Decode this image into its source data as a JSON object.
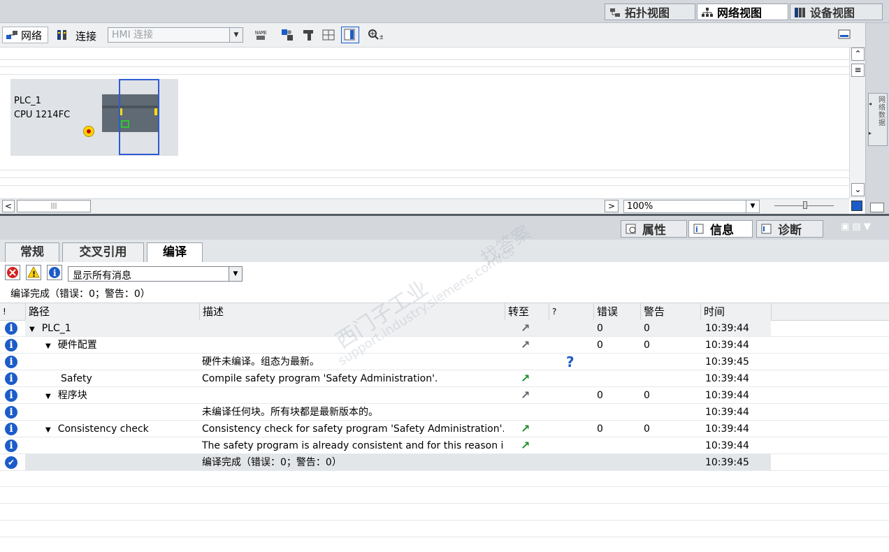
{
  "view_tabs": {
    "topology": "拓扑视图",
    "network": "网络视图",
    "device": "设备视图"
  },
  "toolbar": {
    "network_label": "网络",
    "connection_label": "连接",
    "connection_type": "HMI 连接"
  },
  "device": {
    "name": "PLC_1",
    "type": "CPU 1214FC"
  },
  "side_panel_label": "网络数据",
  "zoom": "100%",
  "inspector_tabs": {
    "properties": "属性",
    "info": "信息",
    "diagnostics": "诊断"
  },
  "sub_tabs": {
    "general": "常规",
    "cross_ref": "交叉引用",
    "compile": "编译"
  },
  "filter": {
    "selected": "显示所有消息"
  },
  "summary": "编译完成（错误：0；警告：0）",
  "columns": {
    "flag": "!",
    "path": "路径",
    "description": "描述",
    "goto": "转至",
    "question": "?",
    "errors": "错误",
    "warnings": "警告",
    "time": "时间"
  },
  "rows": [
    {
      "level": 0,
      "path": "PLC_1",
      "expand": true,
      "desc": "",
      "goto": "grey",
      "q": "",
      "errors": "0",
      "warnings": "0",
      "time": "10:39:44",
      "icon": "info"
    },
    {
      "level": 1,
      "path": "硬件配置",
      "expand": true,
      "desc": "",
      "goto": "grey",
      "q": "",
      "errors": "0",
      "warnings": "0",
      "time": "10:39:44",
      "icon": "info"
    },
    {
      "level": 2,
      "path": "",
      "expand": false,
      "desc": "硬件未编译。组态为最新。",
      "goto": "",
      "q": "?",
      "errors": "",
      "warnings": "",
      "time": "10:39:45",
      "icon": "info"
    },
    {
      "level": 2,
      "path": "Safety",
      "expand": false,
      "desc": "Compile safety program 'Safety Administration'.",
      "goto": "green",
      "q": "",
      "errors": "",
      "warnings": "",
      "time": "10:39:44",
      "icon": "info"
    },
    {
      "level": 1,
      "path": "程序块",
      "expand": true,
      "desc": "",
      "goto": "grey",
      "q": "",
      "errors": "0",
      "warnings": "0",
      "time": "10:39:44",
      "icon": "info"
    },
    {
      "level": 2,
      "path": "",
      "expand": false,
      "desc": "未编译任何块。所有块都是最新版本的。",
      "goto": "",
      "q": "",
      "errors": "",
      "warnings": "",
      "time": "10:39:44",
      "icon": "info"
    },
    {
      "level": 1,
      "path": "Consistency check",
      "expand": true,
      "desc": "Consistency check for safety program 'Safety Administration'.",
      "goto": "green",
      "q": "",
      "errors": "0",
      "warnings": "0",
      "time": "10:39:44",
      "icon": "info"
    },
    {
      "level": 2,
      "path": "",
      "expand": false,
      "desc": "The safety program is already consistent and for this reason is n",
      "goto": "green",
      "q": "",
      "errors": "",
      "warnings": "",
      "time": "10:39:44",
      "icon": "info"
    },
    {
      "level": 0,
      "path": "",
      "expand": false,
      "desc": "编译完成（错误：0；警告：0）",
      "goto": "",
      "q": "",
      "errors": "",
      "warnings": "",
      "time": "10:39:45",
      "icon": "ok"
    }
  ],
  "watermark": {
    "line1": "西门子工业",
    "line2": "找答案",
    "line3": "support.industry.siemens.com/cs"
  },
  "colors": {
    "accent_blue": "#1c5cc8",
    "selection_blue": "#2f5bd3",
    "goto_green": "#1f8a2b",
    "goto_grey": "#5e646b"
  }
}
